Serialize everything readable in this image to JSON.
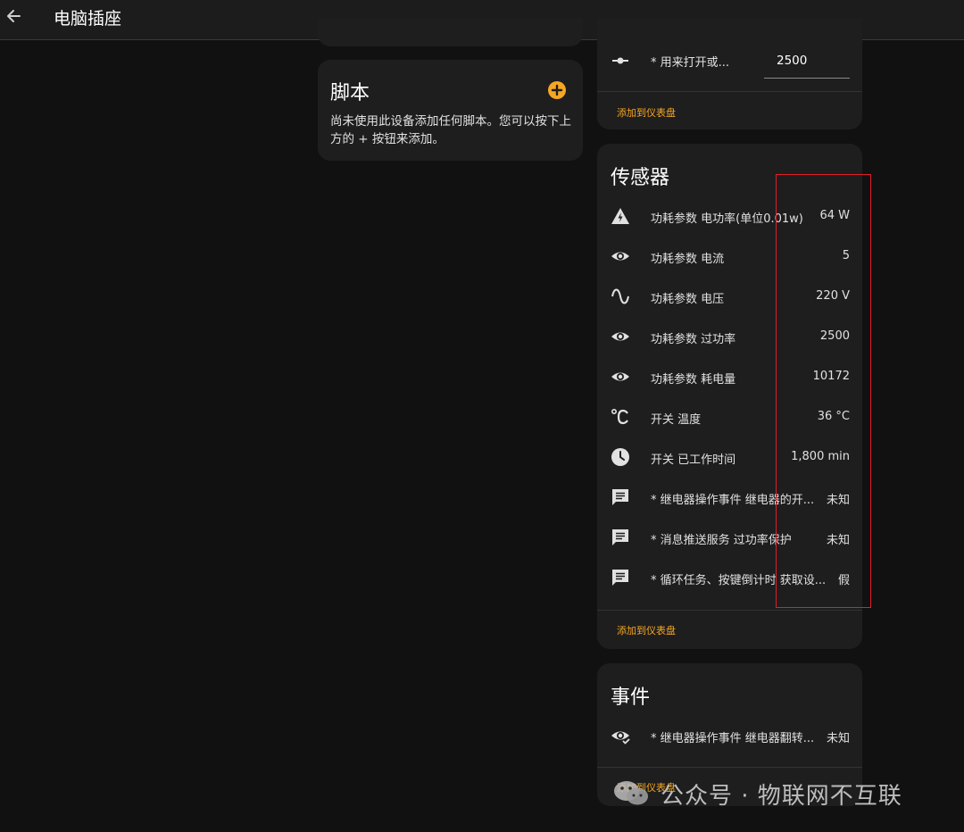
{
  "header": {
    "title": "电脑插座",
    "back_icon": "arrow-left-icon"
  },
  "scripts_card": {
    "title": "脚本",
    "description": "尚未使用此设备添加任何脚本。您可以按下上方的 + 按钮来添加。",
    "add_icon": "plus-circle-icon"
  },
  "controls_card": {
    "item": {
      "icon": "slider-icon",
      "label": "* 用来打开或...",
      "value": "2500"
    },
    "add_to_dashboard": "添加到仪表盘"
  },
  "sensors_card": {
    "title": "传感器",
    "items": [
      {
        "icon": "flash-triangle-icon",
        "label": "功耗参数 电功率(单位0.01w)",
        "value": "64 W"
      },
      {
        "icon": "eye-icon",
        "label": "功耗参数 电流",
        "value": "5"
      },
      {
        "icon": "sine-wave-icon",
        "label": "功耗参数 电压",
        "value": "220 V"
      },
      {
        "icon": "eye-icon",
        "label": "功耗参数 过功率",
        "value": "2500"
      },
      {
        "icon": "eye-icon",
        "label": "功耗参数 耗电量",
        "value": "10172"
      },
      {
        "icon": "celsius-icon",
        "label": "开关 温度",
        "value": "36 °C"
      },
      {
        "icon": "clock-icon",
        "label": "开关 已工作时间",
        "value": "1,800 min"
      },
      {
        "icon": "message-icon",
        "label": "* 继电器操作事件 继电器的开...",
        "value": "未知"
      },
      {
        "icon": "message-icon",
        "label": "* 消息推送服务 过功率保护",
        "value": "未知"
      },
      {
        "icon": "message-icon",
        "label": "* 循环任务、按键倒计时 获取设...",
        "value": "假"
      }
    ],
    "add_to_dashboard": "添加到仪表盘"
  },
  "events_card": {
    "title": "事件",
    "items": [
      {
        "icon": "eye-check-icon",
        "label": "* 继电器操作事件 继电器翻转...",
        "value": "未知"
      }
    ],
    "add_to_dashboard": "添加到仪表盘"
  },
  "watermark": {
    "text": "公众号 · 物联网不互联"
  },
  "colors": {
    "accent": "#f5a623",
    "highlight_box": "#e0202a",
    "card_bg": "#1e1e1e",
    "page_bg": "#111111"
  }
}
